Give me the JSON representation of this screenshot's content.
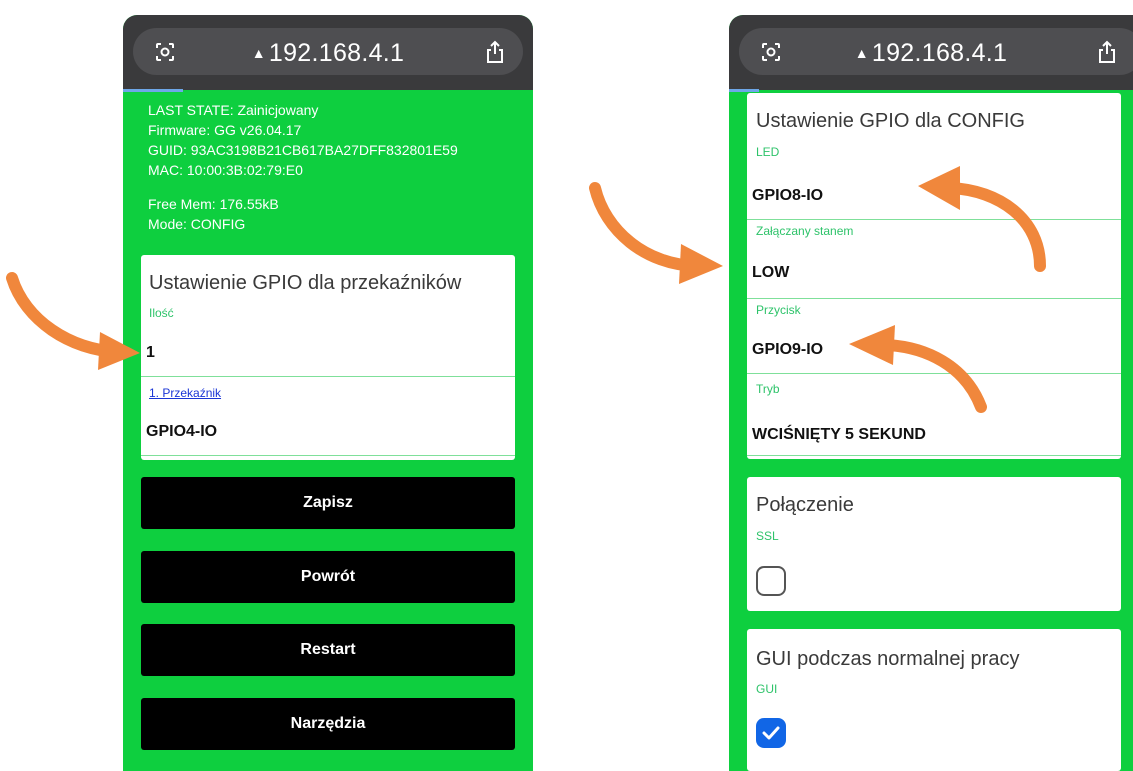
{
  "browser": {
    "url": "192.168.4.1",
    "warning_glyph": "▲",
    "scan_icon": "camera-scan-icon",
    "share_icon": "share-icon"
  },
  "left": {
    "status": {
      "last_state": "LAST STATE: Zainicjowany",
      "firmware": "Firmware: GG v26.04.17",
      "guid": "GUID: 93AC3198B21CB617BA27DFF832801E59",
      "mac": "MAC: 10:00:3B:02:79:E0",
      "free_mem": "Free Mem: 176.55kB",
      "mode": "Mode: CONFIG"
    },
    "relay_card": {
      "title": "Ustawienie GPIO dla przekaźników",
      "count_label": "Ilość",
      "count_value": "1",
      "relay_link": "1. Przekaźnik",
      "relay_value": "GPIO4-IO"
    },
    "buttons": {
      "save": "Zapisz",
      "back": "Powrót",
      "restart": "Restart",
      "tools": "Narzędzia"
    }
  },
  "right": {
    "config_card": {
      "title": "Ustawienie GPIO dla CONFIG",
      "led_label": "LED",
      "led_value": "GPIO8-IO",
      "state_label": "Załączany stanem",
      "state_value": "LOW",
      "button_label": "Przycisk",
      "button_value": "GPIO9-IO",
      "mode_label": "Tryb",
      "mode_value": "WCIŚNIĘTY 5 SEKUND"
    },
    "connection_card": {
      "title": "Połączenie",
      "ssl_label": "SSL",
      "ssl_checked": false
    },
    "gui_card": {
      "title": "GUI podczas normalnej pracy",
      "gui_label": "GUI",
      "gui_checked": true
    }
  },
  "colors": {
    "background": "#0ecf3f",
    "arrow": "#f0873c",
    "label": "#2ec36a",
    "checkbox": "#1166e6"
  }
}
